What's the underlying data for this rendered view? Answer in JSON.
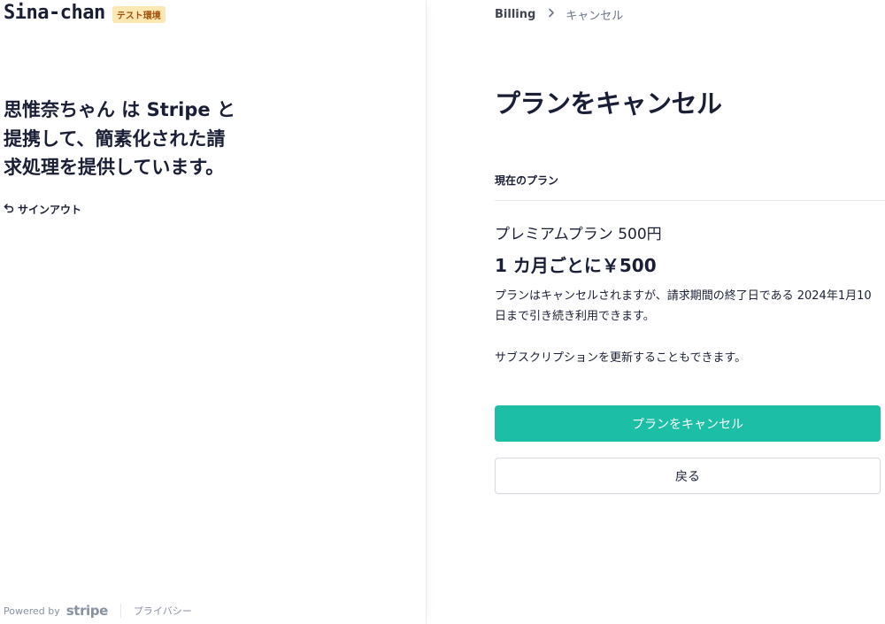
{
  "brand": {
    "name": "Sina-chan",
    "badge": "テスト環境"
  },
  "left": {
    "headline": "思惟奈ちゃん は Stripe と提携して、簡素化された請求処理を提供しています。",
    "signout_label": "サインアウト",
    "footer": {
      "powered_by": "Powered by",
      "stripe": "stripe",
      "privacy": "プライバシー"
    }
  },
  "breadcrumb": {
    "billing": "Billing",
    "current": "キャンセル"
  },
  "main": {
    "title": "プランをキャンセル",
    "current_plan_label": "現在のプラン",
    "plan_name": "プレミアムプラン 500円",
    "plan_price": "1 カ月ごとに￥500",
    "notice": "プランはキャンセルされますが、請求期間の終了日である 2024年1月10日まで引き続き利用できます。",
    "renew_note": "サブスクリプションを更新することもできます。",
    "cancel_button": "プランをキャンセル",
    "back_button": "戻る"
  },
  "colors": {
    "accent": "#1cbfa6",
    "badge_bg": "#fde7b3",
    "badge_text": "#a3520b",
    "text": "#1a1f36",
    "muted": "#8792a2"
  },
  "icons": {
    "signout": "undo-arrow-icon",
    "breadcrumb_separator": "chevron-right-icon"
  }
}
